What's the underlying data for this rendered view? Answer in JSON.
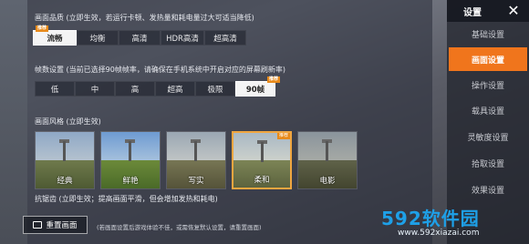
{
  "quality": {
    "label": "画面品质 (立即生效，若运行卡顿、发热量和耗电量过大可适当降低)",
    "options": [
      "流畅",
      "均衡",
      "高清",
      "HDR高清",
      "超高清"
    ],
    "selected_index": 0,
    "badge": "推荐"
  },
  "framerate": {
    "label": "帧数设置 (当前已选择90帧帧率，请确保在手机系统中开启对应的屏幕刷新率)",
    "options": [
      "低",
      "中",
      "高",
      "超高",
      "极限",
      "90帧"
    ],
    "selected_index": 5,
    "badge": "推荐"
  },
  "style": {
    "label": "画面风格 (立即生效)",
    "options": [
      "经典",
      "鲜艳",
      "写实",
      "柔和",
      "电影"
    ],
    "selected_index": 3,
    "badge": "推荐"
  },
  "antialias": {
    "label": "抗锯齿 (立即生效；提高画面平滑，但会增加发热和耗电)"
  },
  "footer": {
    "reset_label": "重置画面",
    "note": "(若画面设置后游戏体验不佳，或需恢复默认设置，请重置画面)"
  },
  "sidebar": {
    "title": "设置",
    "items": [
      "基础设置",
      "画面设置",
      "操作设置",
      "载具设置",
      "灵敏度设置",
      "拾取设置",
      "效果设置"
    ],
    "selected_index": 1
  },
  "watermark": {
    "logo": "592软件园",
    "url": "www.592xiazai.com"
  },
  "colors": {
    "accent": "#f0751c",
    "badge": "#e88a1a",
    "watermark": "#1ea0e8"
  }
}
